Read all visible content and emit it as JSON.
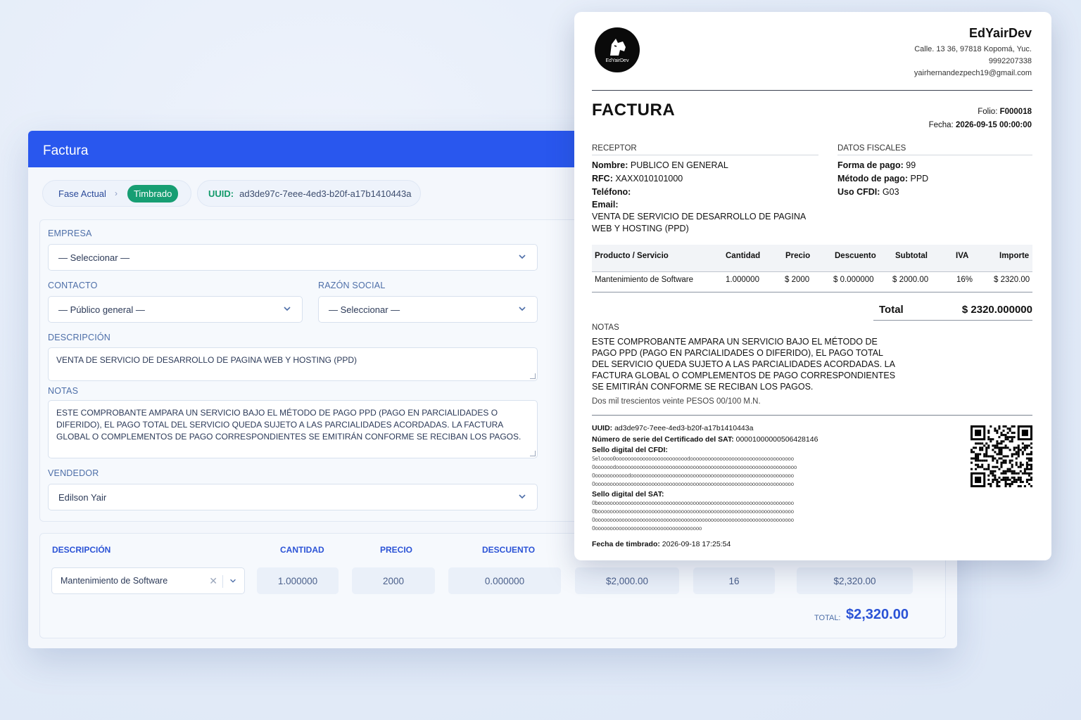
{
  "form": {
    "title": "Factura",
    "fase_label": "Fase Actual",
    "fase_status": "Timbrado",
    "uuid_label": "UUID:",
    "uuid_value": "ad3de97c-7eee-4ed3-b20f-a17b1410443a",
    "empresa": {
      "label": "EMPRESA",
      "value": "— Seleccionar —"
    },
    "contacto": {
      "label": "CONTACTO",
      "value": "— Público general —"
    },
    "razon_social": {
      "label": "RAZÓN SOCIAL",
      "value": "— Seleccionar —"
    },
    "descripcion": {
      "label": "DESCRIPCIÓN",
      "value": "VENTA DE SERVICIO DE DESARROLLO DE PAGINA WEB Y HOSTING (PPD)"
    },
    "notas": {
      "label": "NOTAS",
      "value": "ESTE COMPROBANTE AMPARA UN SERVICIO BAJO EL MÉTODO DE PAGO PPD (PAGO EN PARCIALIDADES O DIFERIDO), EL PAGO TOTAL DEL SERVICIO QUEDA SUJETO A LAS PARCIALIDADES ACORDADAS. LA FACTURA GLOBAL O COMPLEMENTOS DE PAGO CORRESPONDIENTES SE EMITIRÁN CONFORME SE RECIBAN LOS PAGOS."
    },
    "vendedor": {
      "label": "VENDEDOR",
      "value": "Edilson Yair"
    },
    "items_headers": {
      "descripcion": "DESCRIPCIÓN",
      "cantidad": "CANTIDAD",
      "precio": "PRECIO",
      "descuento": "DESCUENTO"
    },
    "item": {
      "producto": "Mantenimiento de Software",
      "cantidad": "1.000000",
      "precio": "2000",
      "descuento": "0.000000",
      "subtotal": "$2,000.00",
      "iva": "16",
      "importe": "$2,320.00"
    },
    "total_label": "TOTAL:",
    "total_value": "$2,320.00"
  },
  "invoice": {
    "logo_text": "EdYairDev",
    "company": "EdYairDev",
    "address": "Calle. 13 36, 97818 Kopomá, Yuc.",
    "phone": "9992207338",
    "email": "yairhernandezpech19@gmail.com",
    "doc_title": "FACTURA",
    "folio_label": "Folio:",
    "folio": "F000018",
    "fecha_label": "Fecha:",
    "fecha": "2026-09-15 00:00:00",
    "receptor": {
      "heading": "RECEPTOR",
      "nombre_label": "Nombre:",
      "nombre": "PUBLICO EN GENERAL",
      "rfc_label": "RFC:",
      "rfc": "XAXX010101000",
      "telefono_label": "Teléfono:",
      "email_label": "Email:",
      "descripcion": "VENTA DE SERVICIO DE DESARROLLO DE PAGINA WEB Y HOSTING (PPD)"
    },
    "fiscales": {
      "heading": "DATOS FISCALES",
      "forma_label": "Forma de pago:",
      "forma": "99",
      "metodo_label": "Método de pago:",
      "metodo": "PPD",
      "uso_label": "Uso CFDI:",
      "uso": "G03"
    },
    "table_headers": [
      "Producto / Servicio",
      "Cantidad",
      "Precio",
      "Descuento",
      "Subtotal",
      "IVA",
      "Importe"
    ],
    "table_row": [
      "Mantenimiento de Software",
      "1.000000",
      "$ 2000",
      "$ 0.000000",
      "$ 2000.00",
      "16%",
      "$ 2320.00"
    ],
    "total_label": "Total",
    "total_value": "$ 2320.000000",
    "notas_heading": "NOTAS",
    "notas": "ESTE COMPROBANTE AMPARA UN SERVICIO BAJO EL MÉTODO DE PAGO PPD (PAGO EN PARCIALIDADES O DIFERIDO), EL PAGO TOTAL DEL SERVICIO QUEDA SUJETO A LAS PARCIALIDADES ACORDADAS. LA FACTURA GLOBAL O COMPLEMENTOS DE PAGO CORRESPONDIENTES SE EMITIRÁN CONFORME SE RECIBAN LOS PAGOS.",
    "importe_letra": "Dos mil trescientos veinte PESOS 00/100 M.N.",
    "uuid_label": "UUID:",
    "uuid": "ad3de97c-7eee-4ed3-b20f-a17b1410443a",
    "serie_label": "Número de serie del Certificado del SAT:",
    "serie": "00001000000506428146",
    "sello_cfdi_label": "Sello digital del CFDI:",
    "sello_sat_label": "Sello digital del SAT:",
    "timbrado_label": "Fecha de timbrado:",
    "timbrado": "2026-09-18 17:25:54"
  }
}
